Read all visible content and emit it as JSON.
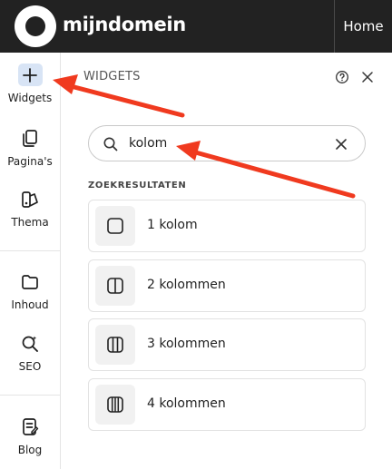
{
  "topbar": {
    "brand": "mijndomein",
    "home_label": "Home"
  },
  "rail": {
    "items": [
      {
        "label": "Widgets",
        "icon": "plus-icon",
        "active": true
      },
      {
        "label": "Pagina's",
        "icon": "pages-icon"
      },
      {
        "label": "Thema",
        "icon": "palette-icon"
      },
      {
        "label": "Inhoud",
        "icon": "folder-icon"
      },
      {
        "label": "SEO",
        "icon": "seo-search-icon"
      },
      {
        "label": "Blog",
        "icon": "blog-icon"
      }
    ]
  },
  "panel": {
    "title": "WIDGETS",
    "search": {
      "value": "kolom",
      "placeholder": ""
    },
    "section_label": "ZOEKRESULTATEN",
    "results": [
      {
        "label": "1 kolom",
        "icon": "one-column-icon"
      },
      {
        "label": "2 kolommen",
        "icon": "two-columns-icon"
      },
      {
        "label": "3 kolommen",
        "icon": "three-columns-icon"
      },
      {
        "label": "4 kolommen",
        "icon": "four-columns-icon"
      }
    ]
  },
  "colors": {
    "topbar": "#222222",
    "active_bg": "#d8e4f5",
    "annotation_arrow": "#f03a1f"
  }
}
